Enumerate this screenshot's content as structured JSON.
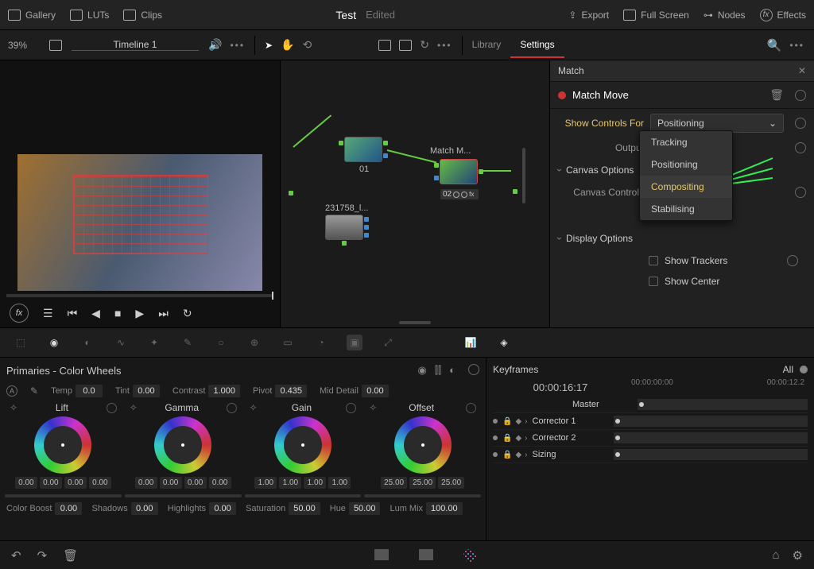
{
  "topbar": {
    "gallery": "Gallery",
    "luts": "LUTs",
    "clips": "Clips",
    "title": "Test",
    "status": "Edited",
    "export": "Export",
    "fullscreen": "Full Screen",
    "nodes": "Nodes",
    "effects": "Effects"
  },
  "subbar": {
    "zoom": "39%",
    "timeline": "Timeline 1",
    "tabs": {
      "library": "Library",
      "settings": "Settings"
    }
  },
  "inspector": {
    "search": "Match",
    "effect_name": "Match Move",
    "rows": {
      "show_controls": "Show Controls For",
      "show_controls_value": "Positioning",
      "output": "Output",
      "canvas_options": "Canvas Options",
      "canvas_controls": "Canvas Controls",
      "display_options": "Display Options",
      "show_trackers": "Show Trackers",
      "show_center": "Show Center"
    },
    "dropdown": {
      "opt1": "Tracking",
      "opt2": "Positioning",
      "opt3": "Compositing",
      "opt4": "Stabilising"
    }
  },
  "nodes": {
    "n1": "01",
    "n2": "02",
    "n2_label": "Match M...",
    "n3": "231758_l..."
  },
  "tools_panel": {
    "title": "Primaries - Color Wheels",
    "params": {
      "temp": "Temp",
      "temp_v": "0.0",
      "tint": "Tint",
      "tint_v": "0.00",
      "contrast": "Contrast",
      "contrast_v": "1.000",
      "pivot": "Pivot",
      "pivot_v": "0.435",
      "middetail": "Mid Detail",
      "middetail_v": "0.00"
    },
    "wheels": [
      {
        "name": "Lift",
        "vals": [
          "0.00",
          "0.00",
          "0.00",
          "0.00"
        ]
      },
      {
        "name": "Gamma",
        "vals": [
          "0.00",
          "0.00",
          "0.00",
          "0.00"
        ]
      },
      {
        "name": "Gain",
        "vals": [
          "1.00",
          "1.00",
          "1.00",
          "1.00"
        ]
      },
      {
        "name": "Offset",
        "vals": [
          "25.00",
          "25.00",
          "25.00"
        ]
      }
    ],
    "bottom": {
      "colorboost": "Color Boost",
      "colorboost_v": "0.00",
      "shadows": "Shadows",
      "shadows_v": "0.00",
      "highlights": "Highlights",
      "highlights_v": "0.00",
      "saturation": "Saturation",
      "saturation_v": "50.00",
      "hue": "Hue",
      "hue_v": "50.00",
      "lummix": "Lum Mix",
      "lummix_v": "100.00"
    }
  },
  "keyframes": {
    "title": "Keyframes",
    "all": "All",
    "time": "00:00:16:17",
    "t_start": "00:00:00:00",
    "t_end": "00:00:12.2",
    "rows": [
      "Master",
      "Corrector 1",
      "Corrector 2",
      "Sizing"
    ]
  }
}
